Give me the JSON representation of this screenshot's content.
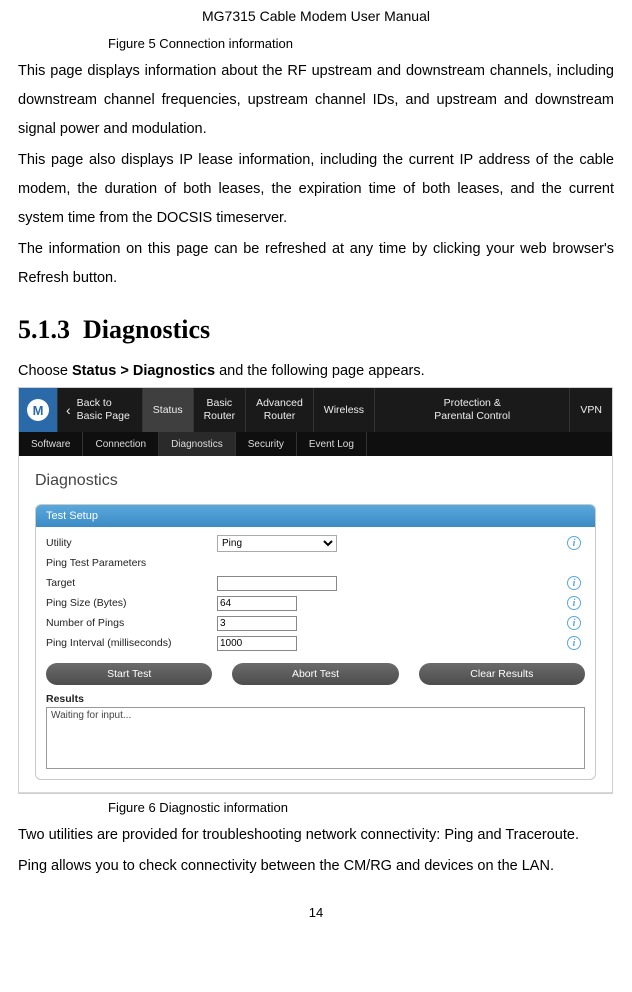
{
  "header": {
    "title": "MG7315 Cable Modem User Manual"
  },
  "fig5_caption": "Figure 5 Connection information",
  "para1": "This page displays information about the RF upstream and downstream channels, including downstream channel frequencies, upstream channel IDs, and upstream and downstream signal power and modulation.",
  "para2": "This page also displays IP lease information, including the current IP address of the cable modem, the duration of both leases, the expiration time of both leases, and the current system time from the DOCSIS timeserver.",
  "para3": "The information on this page can be refreshed at any time by clicking your web browser's Refresh button.",
  "section_number": "5.1.3",
  "section_title": "Diagnostics",
  "choose_prefix": "Choose ",
  "choose_bold": "Status > Diagnostics",
  "choose_suffix": " and the following page appears.",
  "app": {
    "back_label1": "Back to",
    "back_label2": "Basic Page",
    "nav": {
      "status": "Status",
      "basic_router1": "Basic",
      "basic_router2": "Router",
      "adv_router1": "Advanced",
      "adv_router2": "Router",
      "wireless": "Wireless",
      "protection1": "Protection &",
      "protection2": "Parental Control",
      "vpn": "VPN"
    },
    "subnav": {
      "software": "Software",
      "connection": "Connection",
      "diagnostics": "Diagnostics",
      "security": "Security",
      "eventlog": "Event Log"
    },
    "diag_title": "Diagnostics",
    "panel_header": "Test Setup",
    "rows": {
      "utility": "Utility",
      "utility_value": "Ping",
      "params": "Ping Test Parameters",
      "target": "Target",
      "target_value": "",
      "size": "Ping Size (Bytes)",
      "size_value": "64",
      "num": "Number of Pings",
      "num_value": "3",
      "interval": "Ping Interval (milliseconds)",
      "interval_value": "1000"
    },
    "buttons": {
      "start": "Start Test",
      "abort": "Abort Test",
      "clear": "Clear Results"
    },
    "results_label": "Results",
    "results_text": "Waiting for input..."
  },
  "fig6_caption": "Figure 6 Diagnostic information",
  "para4": "Two utilities are provided for troubleshooting network connectivity: Ping and Traceroute.",
  "para5": "Ping allows you to check connectivity between the CM/RG and devices on the LAN.",
  "page_number": "14"
}
